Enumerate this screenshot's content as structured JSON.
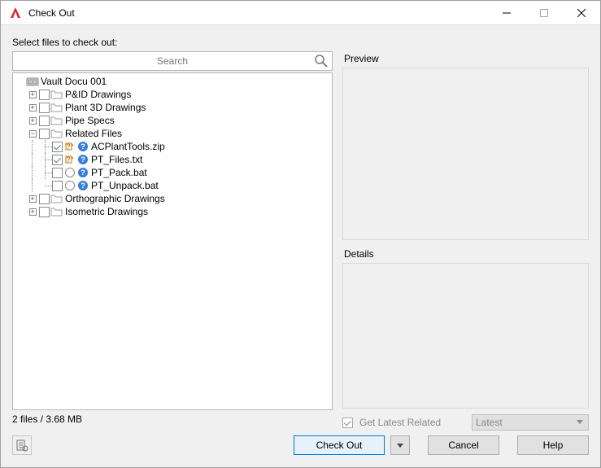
{
  "window": {
    "title": "Check Out"
  },
  "header_label": "Select files to check out:",
  "search": {
    "placeholder": "Search"
  },
  "tree": {
    "root": {
      "label": "Vault Docu 001"
    },
    "folders": [
      {
        "label": "P&ID Drawings"
      },
      {
        "label": "Plant 3D Drawings"
      },
      {
        "label": "Pipe Specs"
      },
      {
        "label": "Related Files"
      },
      {
        "label": "Orthographic Drawings"
      },
      {
        "label": "Isometric Drawings"
      }
    ],
    "related_files": [
      {
        "label": "ACPlantTools.zip",
        "checked": true,
        "status": "changed"
      },
      {
        "label": "PT_Files.txt",
        "checked": true,
        "status": "changed"
      },
      {
        "label": "PT_Pack.bat",
        "checked": false,
        "status": "clean"
      },
      {
        "label": "PT_Unpack.bat",
        "checked": false,
        "status": "clean"
      }
    ]
  },
  "preview": {
    "label": "Preview"
  },
  "details": {
    "label": "Details"
  },
  "get_latest": {
    "label": "Get Latest Related",
    "checked": true
  },
  "version_combo": {
    "value": "Latest"
  },
  "status": "2 files / 3.68 MB",
  "buttons": {
    "checkout": "Check Out",
    "cancel": "Cancel",
    "help": "Help"
  }
}
